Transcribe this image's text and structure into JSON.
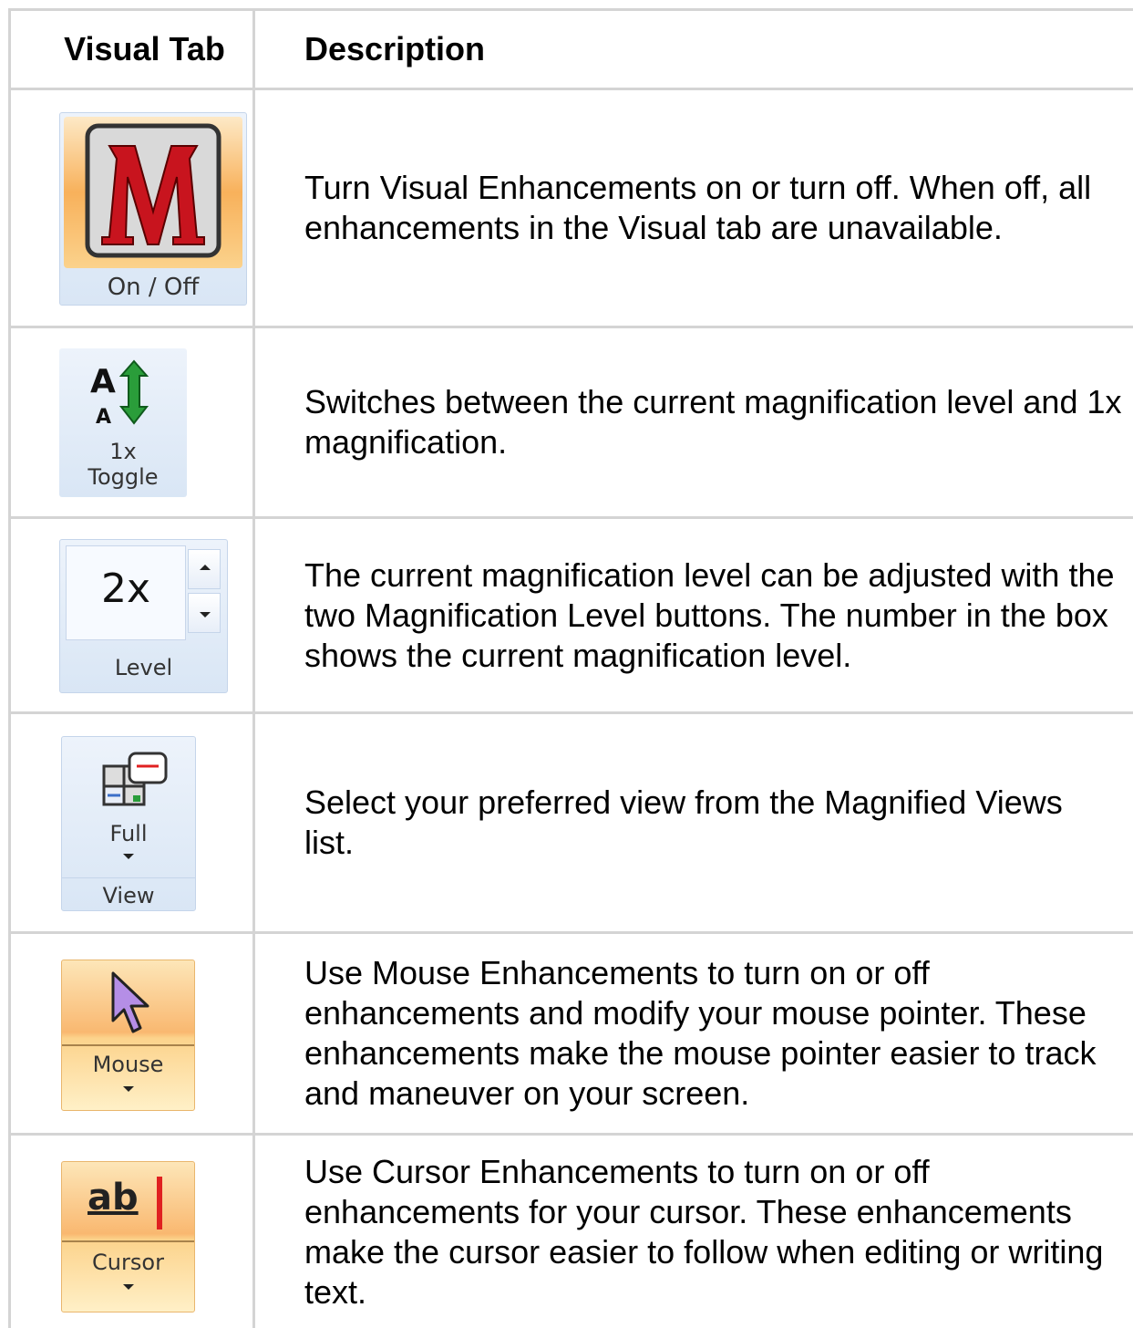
{
  "header": {
    "col1": "Visual Tab",
    "col2": "Description"
  },
  "rows": [
    {
      "name": "on-off",
      "button": {
        "label": "On / Off",
        "icon": "magic-m-icon",
        "colors": {
          "m": "#c8141e",
          "frame": "#fbd28c"
        }
      },
      "description": "Turn Visual Enhancements on or turn off. When off, all enhancements in the Visual tab are unavailable."
    },
    {
      "name": "1x-toggle",
      "button": {
        "label_line1": "1x",
        "label_line2": "Toggle",
        "icon": "text-size-arrow-icon",
        "colors": {
          "arrow": "#2a9d3a"
        }
      },
      "description": "Switches between the current magnification level and 1x magnification."
    },
    {
      "name": "level",
      "button": {
        "value": "2x",
        "label": "Level",
        "icon": "spin-up-down-icon"
      },
      "description": "The current magnification level can be adjusted with the two Magnification Level buttons. The number in the box shows the current magnification level."
    },
    {
      "name": "view",
      "button": {
        "label": "Full",
        "group_label": "View",
        "icon": "magnified-views-icon"
      },
      "description": "Select your preferred view from the Magnified Views list."
    },
    {
      "name": "mouse",
      "button": {
        "label": "Mouse",
        "icon": "mouse-pointer-icon",
        "colors": {
          "pointer": "#b58ee6"
        }
      },
      "description": "Use Mouse Enhancements to turn on or off enhancements and modify your mouse pointer. These enhancements make the mouse pointer easier to track and maneuver on your screen."
    },
    {
      "name": "cursor",
      "button": {
        "label": "Cursor",
        "icon_text": "ab",
        "icon": "text-cursor-icon",
        "colors": {
          "bar": "#e02020"
        }
      },
      "description": "Use Cursor Enhancements to turn on or off enhancements for your cursor. These enhancements make the cursor easier to follow when editing or writing text."
    }
  ]
}
